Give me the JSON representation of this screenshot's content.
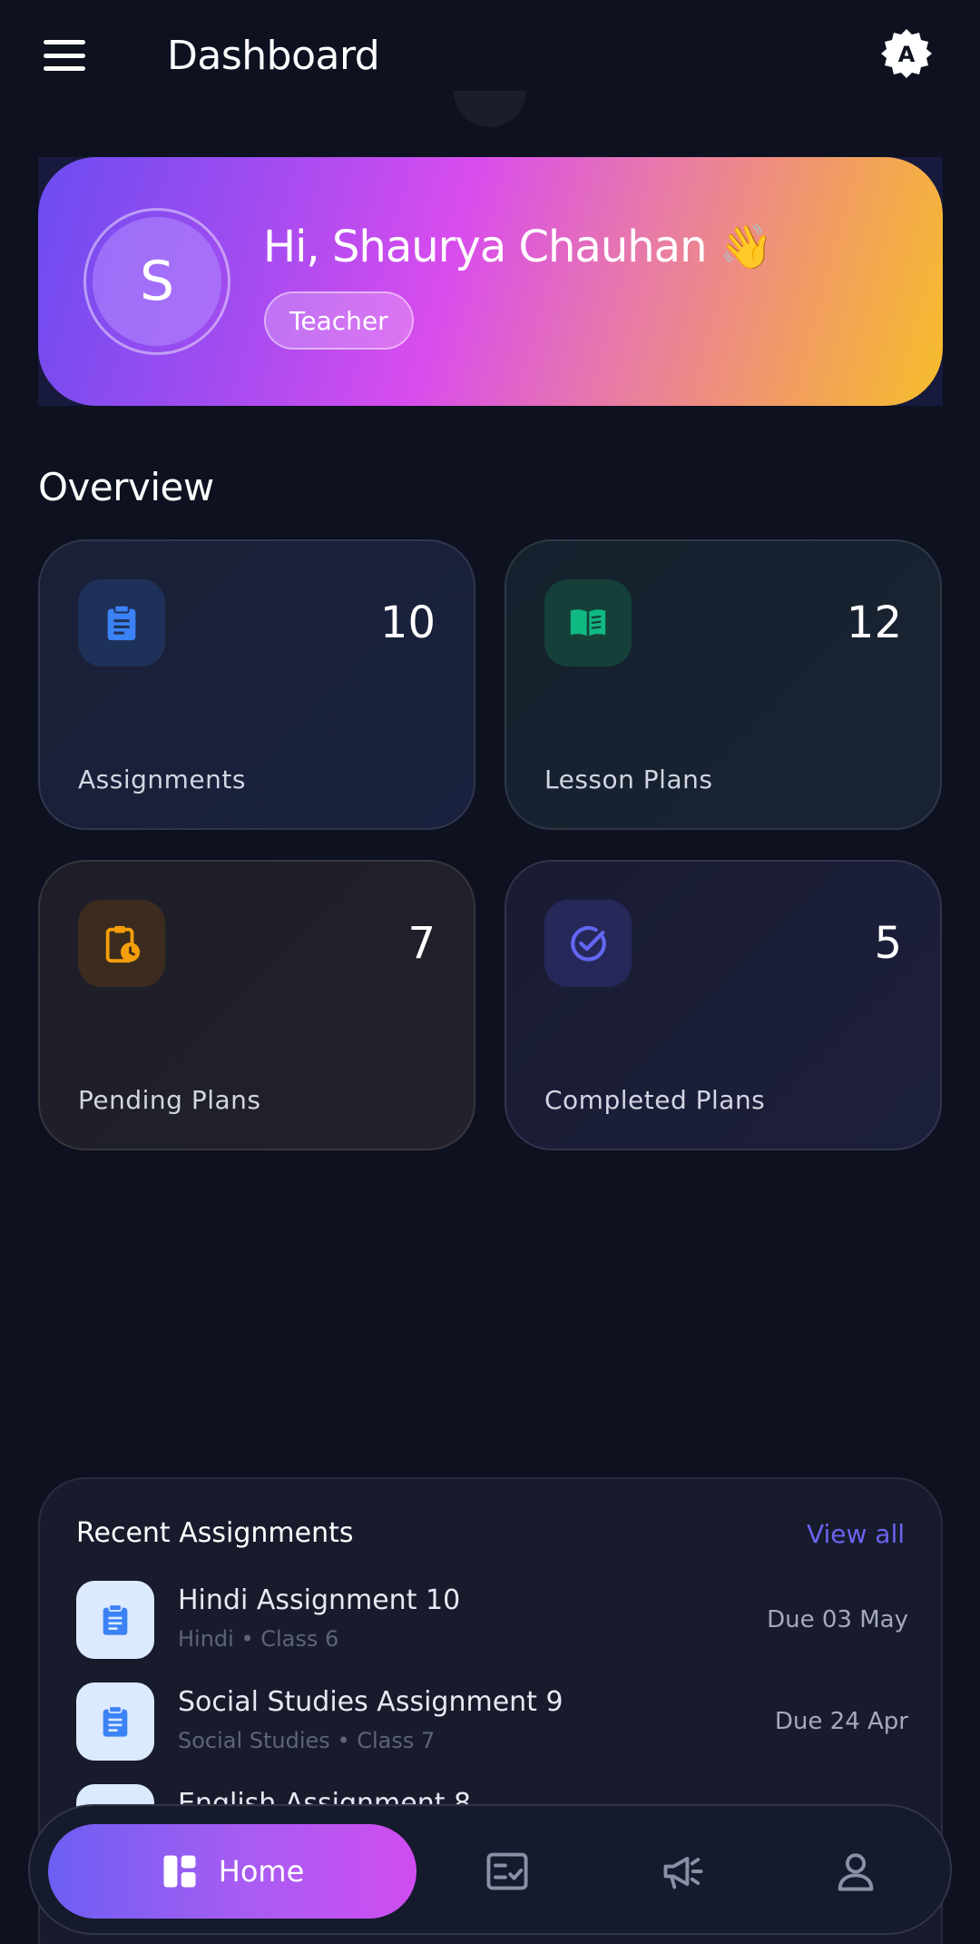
{
  "header": {
    "title": "Dashboard",
    "badge_letter": "A"
  },
  "profile": {
    "avatar_initial": "S",
    "greeting": "Hi, Shaurya Chauhan 👋",
    "role": "Teacher"
  },
  "overview": {
    "title": "Overview",
    "cards": [
      {
        "label": "Assignments",
        "count": "10",
        "icon": "clipboard-icon",
        "accent": "#3b82f6"
      },
      {
        "label": "Lesson Plans",
        "count": "12",
        "icon": "book-icon",
        "accent": "#10b981"
      },
      {
        "label": "Pending Plans",
        "count": "7",
        "icon": "clipboard-clock-icon",
        "accent": "#f59e0b"
      },
      {
        "label": "Completed Plans",
        "count": "5",
        "icon": "check-circle-icon",
        "accent": "#6366f1"
      }
    ]
  },
  "recent": {
    "title": "Recent Assignments",
    "view_all": "View all",
    "items": [
      {
        "title": "Hindi Assignment 10",
        "subtitle": "Hindi • Class 6",
        "due": "Due 03 May"
      },
      {
        "title": "Social Studies Assignment 9",
        "subtitle": "Social Studies • Class 7",
        "due": "Due 24 Apr"
      },
      {
        "title": "English Assignment 8",
        "subtitle": "",
        "due": ""
      }
    ]
  },
  "nav": {
    "home_label": "Home",
    "items": [
      "home-icon",
      "tasks-icon",
      "megaphone-icon",
      "profile-icon"
    ]
  },
  "colors": {
    "background": "#0d1120",
    "accent": "#6b63f0",
    "hero_gradient_start": "#6b4cf0",
    "hero_gradient_end": "#f6bd2a"
  }
}
